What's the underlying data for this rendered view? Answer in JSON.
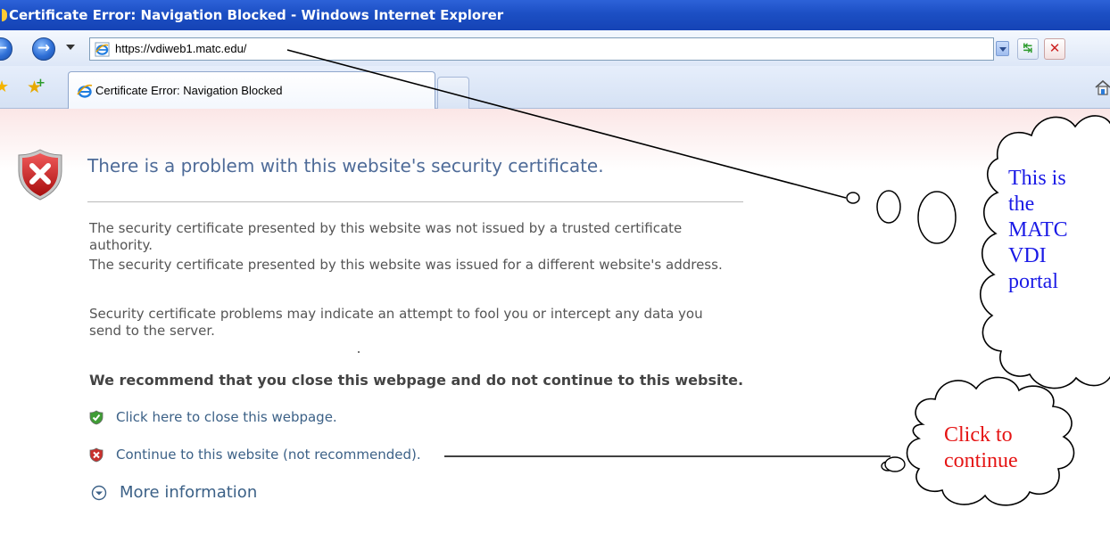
{
  "window": {
    "title": "Certificate Error: Navigation Blocked - Windows Internet Explorer"
  },
  "address_bar": {
    "url": "https://vdiweb1.matc.edu/"
  },
  "tab": {
    "label": "Certificate Error: Navigation Blocked"
  },
  "page": {
    "heading": "There is a problem with this website's security certificate.",
    "paragraph1_line1": "The security certificate presented by this website was not issued by a trusted certificate",
    "paragraph1_line2": "authority.",
    "paragraph2": "The security certificate presented by this website was issued for a different website's address.",
    "paragraph3_line1": "Security certificate problems may indicate an attempt to fool you or intercept any data you",
    "paragraph3_line2": "send to the server.",
    "recommendation": "We recommend that you close this webpage and do not continue to this website.",
    "close_link": "Click here to close this webpage.",
    "continue_link": "Continue to this website (not recommended).",
    "more_info": "More information"
  },
  "annotations": {
    "cloud1_lines": [
      "This is",
      "the",
      "MATC",
      "VDI",
      "portal"
    ],
    "cloud2_lines": [
      "Click to",
      "continue"
    ],
    "cloud1_color": "#1a1ae6",
    "cloud2_color": "#e51414"
  },
  "colors": {
    "titlebar": "#1c4fc4",
    "heading_text": "#4e6b98",
    "link_text": "#3c6187",
    "body_text": "#555555"
  }
}
